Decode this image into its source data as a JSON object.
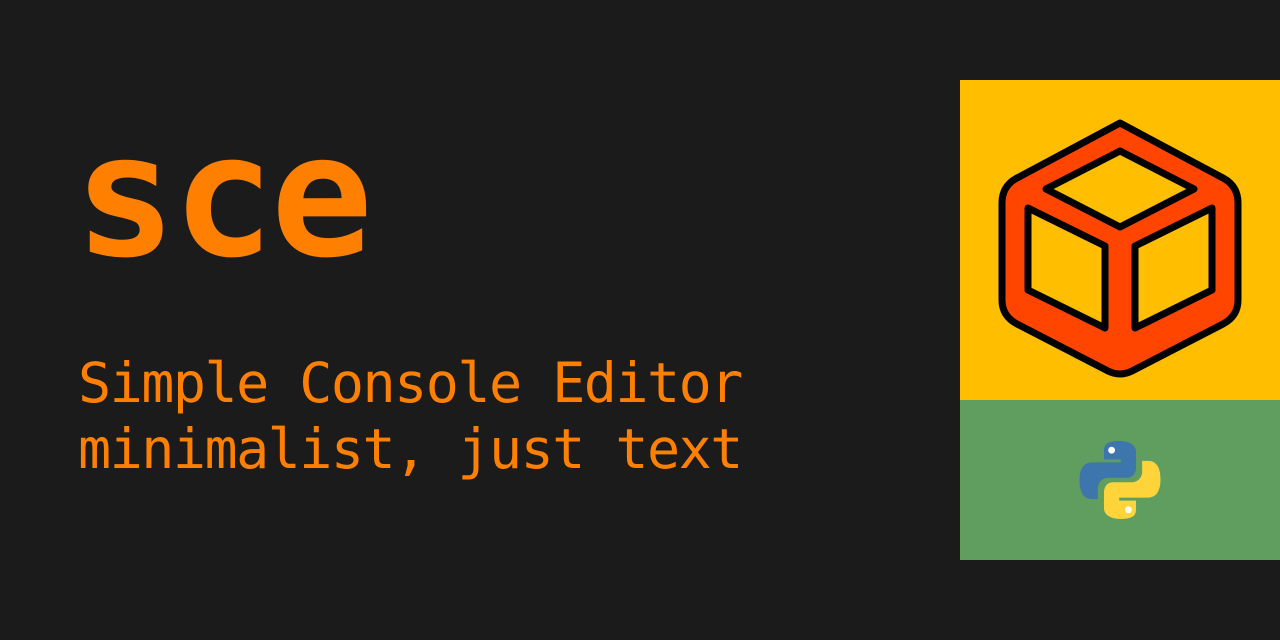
{
  "banner": {
    "title": "sce",
    "tagline_line1": "Simple Console Editor",
    "tagline_line2": "minimalist, just text"
  },
  "icons": {
    "cube_logo": "cube-icon",
    "python_logo": "python-logo-icon"
  },
  "colors": {
    "background": "#1b1b1b",
    "accent_orange": "#ff8000",
    "logo_panel_yellow": "#ffbf00",
    "cube_red": "#ff4500",
    "python_panel_green": "#5f9e5f",
    "python_blue": "#3d75ad",
    "python_yellow": "#ffd43b"
  }
}
